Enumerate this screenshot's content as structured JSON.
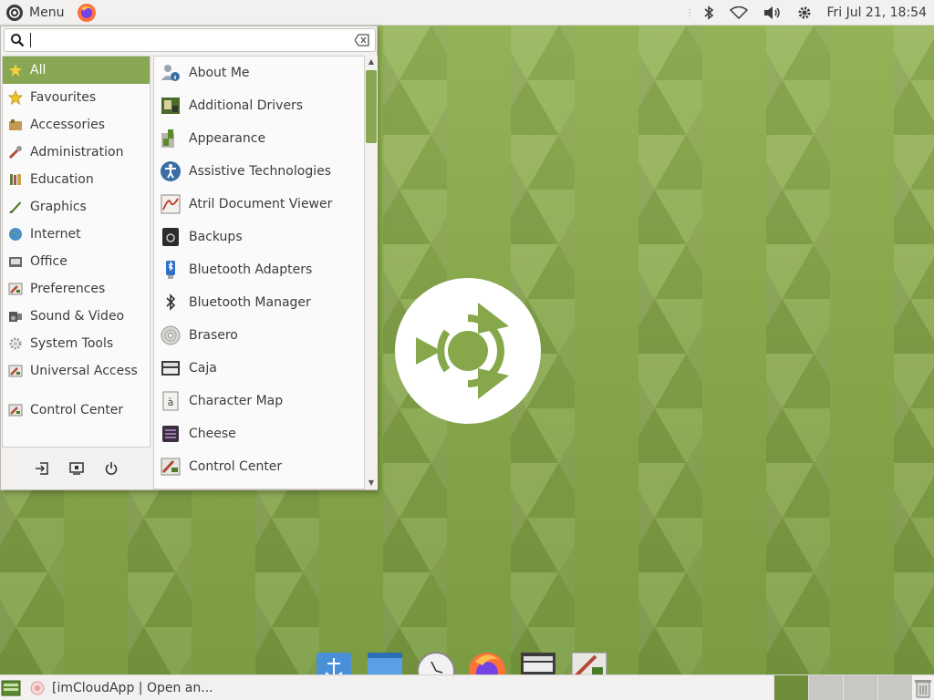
{
  "panel": {
    "menu_label": "Menu",
    "clock": "Fri Jul 21, 18:54"
  },
  "search": {
    "value": "",
    "placeholder": ""
  },
  "categories": [
    {
      "label": "All",
      "icon": "star-icon",
      "selected": true
    },
    {
      "label": "Favourites",
      "icon": "favourite-star-icon"
    },
    {
      "label": "Accessories",
      "icon": "accessories-icon"
    },
    {
      "label": "Administration",
      "icon": "administration-icon"
    },
    {
      "label": "Education",
      "icon": "education-icon"
    },
    {
      "label": "Graphics",
      "icon": "graphics-icon"
    },
    {
      "label": "Internet",
      "icon": "internet-globe-icon"
    },
    {
      "label": "Office",
      "icon": "office-icon"
    },
    {
      "label": "Preferences",
      "icon": "preferences-icon"
    },
    {
      "label": "Sound & Video",
      "icon": "sound-video-icon"
    },
    {
      "label": "System Tools",
      "icon": "system-tools-gear-icon"
    },
    {
      "label": "Universal Access",
      "icon": "universal-access-icon"
    }
  ],
  "control_center_label": "Control Center",
  "apps": [
    {
      "label": "About Me",
      "icon": "about-me-icon"
    },
    {
      "label": "Additional Drivers",
      "icon": "additional-drivers-icon"
    },
    {
      "label": "Appearance",
      "icon": "appearance-icon"
    },
    {
      "label": "Assistive Technologies",
      "icon": "assistive-technologies-icon"
    },
    {
      "label": "Atril Document Viewer",
      "icon": "document-viewer-icon"
    },
    {
      "label": "Backups",
      "icon": "backups-icon"
    },
    {
      "label": "Bluetooth Adapters",
      "icon": "bluetooth-adapters-icon"
    },
    {
      "label": "Bluetooth Manager",
      "icon": "bluetooth-manager-icon"
    },
    {
      "label": "Brasero",
      "icon": "disc-burner-icon"
    },
    {
      "label": "Caja",
      "icon": "file-manager-icon"
    },
    {
      "label": "Character Map",
      "icon": "character-map-icon"
    },
    {
      "label": "Cheese",
      "icon": "webcam-icon"
    },
    {
      "label": "Control Center",
      "icon": "control-center-icon"
    }
  ],
  "taskbar": {
    "task_label": "[imCloudApp | Open an..."
  },
  "colors": {
    "accent": "#87a752",
    "panel_bg": "#f2f1f0",
    "desktop_bg": "#86a84a"
  }
}
